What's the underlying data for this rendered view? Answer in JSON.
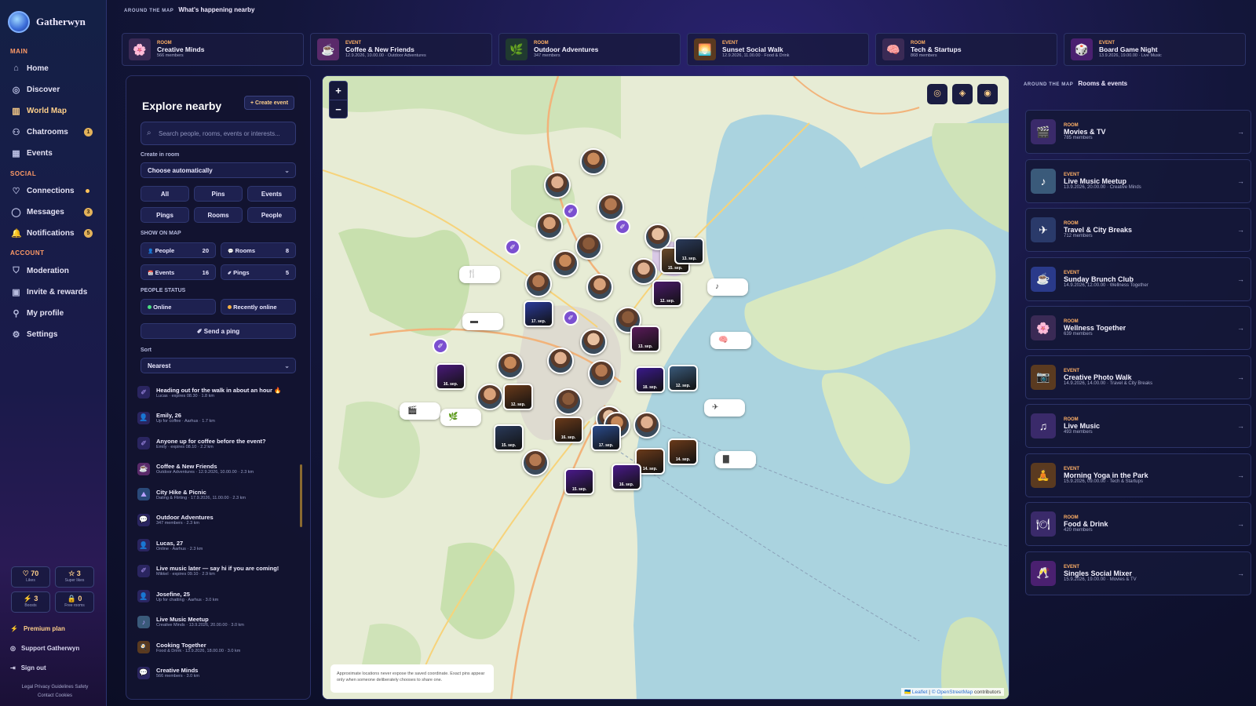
{
  "app": {
    "name": "Gatherwyn"
  },
  "sidebar": {
    "sections": {
      "main": "MAIN",
      "social": "SOCIAL",
      "account": "ACCOUNT"
    },
    "main_items": [
      {
        "label": "Home",
        "icon": "home-icon"
      },
      {
        "label": "Discover",
        "icon": "compass-icon"
      },
      {
        "label": "World Map",
        "icon": "map-icon",
        "active": true
      },
      {
        "label": "Chatrooms",
        "icon": "users-icon",
        "badge": "1"
      },
      {
        "label": "Events",
        "icon": "calendar-icon"
      }
    ],
    "social_items": [
      {
        "label": "Connections",
        "icon": "heart-icon"
      },
      {
        "label": "Messages",
        "icon": "chat-icon",
        "badge": "3"
      },
      {
        "label": "Notifications",
        "icon": "bell-icon",
        "badge": "5"
      }
    ],
    "account_items": [
      {
        "label": "Moderation",
        "icon": "shield-icon"
      },
      {
        "label": "Invite & rewards",
        "icon": "gift-icon"
      },
      {
        "label": "My profile",
        "icon": "user-icon"
      },
      {
        "label": "Settings",
        "icon": "gear-icon"
      }
    ],
    "stats": [
      {
        "value": "70",
        "label": "Likes",
        "icon": "♡"
      },
      {
        "value": "3",
        "label": "Super likes",
        "icon": "☆"
      },
      {
        "value": "3",
        "label": "Boosts",
        "icon": "⚡"
      },
      {
        "value": "0",
        "label": "Free rooms",
        "icon": "🔒"
      }
    ],
    "premium": "Premium plan",
    "support": "Support Gatherwyn",
    "signout": "Sign out",
    "legal_line1": "Legal   Privacy   Guidelines   Safety",
    "legal_line2": "Contact   Cookies"
  },
  "topbar": {
    "kicker": "AROUND THE MAP",
    "title": "What's happening nearby"
  },
  "strip": [
    {
      "type": "ROOM",
      "name": "Creative Minds",
      "sub": "566 members",
      "color": "#3a2a55",
      "glyph": "🌸"
    },
    {
      "type": "EVENT",
      "name": "Coffee & New Friends",
      "sub": "12.9.2026, 10.00.00 · Outdoor Adventures",
      "color": "#5a2a6a",
      "glyph": "☕"
    },
    {
      "type": "ROOM",
      "name": "Outdoor Adventures",
      "sub": "347 members",
      "color": "#203a30",
      "glyph": "🌿"
    },
    {
      "type": "EVENT",
      "name": "Sunset Social Walk",
      "sub": "12.9.2026, 11.00.00 · Food & Drink",
      "color": "#5a3a20",
      "glyph": "🌅"
    },
    {
      "type": "ROOM",
      "name": "Tech & Startups",
      "sub": "868 members",
      "color": "#3a2a55",
      "glyph": "🧠"
    },
    {
      "type": "EVENT",
      "name": "Board Game Night",
      "sub": "13.9.2026, 19.00.00 · Live Music",
      "color": "#4a2070",
      "glyph": "🎲"
    }
  ],
  "explore": {
    "title": "Explore nearby",
    "create_button": "+ Create event",
    "search_placeholder": "Search people, rooms, events or interests...",
    "create_in_room_label": "Create in room",
    "room_select": "Choose automatically",
    "filters_row1": [
      "All",
      "Pins",
      "Events"
    ],
    "filters_row2": [
      "Pings",
      "Rooms",
      "People"
    ],
    "show_on_map_label": "SHOW ON MAP",
    "show_counts": [
      {
        "label": "People",
        "count": "20",
        "icon": "👤"
      },
      {
        "label": "Rooms",
        "count": "8",
        "icon": "💬"
      },
      {
        "label": "Events",
        "count": "16",
        "icon": "📅"
      },
      {
        "label": "Pings",
        "count": "5",
        "icon": "✐"
      }
    ],
    "people_status_label": "PEOPLE STATUS",
    "status": [
      {
        "label": "Online",
        "color": "#4ade80"
      },
      {
        "label": "Recently online",
        "color": "#f5b042"
      }
    ],
    "send_ping": "Send a ping",
    "sort_label": "Sort",
    "sort_value": "Nearest",
    "items": [
      {
        "title": "Heading out for the walk in about an hour 🔥",
        "sub": "Lucas · expires 08.30 · 1.8 km",
        "icon": "✐",
        "bg": "#2a2560"
      },
      {
        "title": "Emily, 26",
        "sub": "Up for coffee · Aarhus · 1.7 km",
        "icon": "👤",
        "bg": "#2a2560"
      },
      {
        "title": "Anyone up for coffee before the event?",
        "sub": "Emily · expires 08.10 · 2.2 km",
        "icon": "✐",
        "bg": "#2a2560"
      },
      {
        "title": "Coffee & New Friends",
        "sub": "Outdoor Adventures · 12.9.2026, 10.00.00 · 2.3 km",
        "icon": "☕",
        "bg": "#5a2a6a"
      },
      {
        "title": "City Hike & Picnic",
        "sub": "Dating & Flirting · 17.9.2026, 11.00.00 · 2.3 km",
        "icon": "⛰",
        "bg": "#2a4a7a"
      },
      {
        "title": "Outdoor Adventures",
        "sub": "347 members · 2.3 km",
        "icon": "💬",
        "bg": "#2a2560"
      },
      {
        "title": "Lucas, 27",
        "sub": "Online · Aarhus · 2.3 km",
        "icon": "👤",
        "bg": "#2a2560"
      },
      {
        "title": "Live music later — say hi if you are coming!",
        "sub": "Mikkel · expires 09.10 · 2.9 km",
        "icon": "✐",
        "bg": "#2a2560"
      },
      {
        "title": "Josefine, 25",
        "sub": "Up for chatting · Aarhus · 3.0 km",
        "icon": "👤",
        "bg": "#2a2560"
      },
      {
        "title": "Live Music Meetup",
        "sub": "Creative Minds · 13.9.2026, 20.00.00 · 3.0 km",
        "icon": "♪",
        "bg": "#3a5a7a"
      },
      {
        "title": "Cooking Together",
        "sub": "Food & Drink · 13.9.2026, 18.00.00 · 3.0 km",
        "icon": "🍳",
        "bg": "#5a3a20"
      },
      {
        "title": "Creative Minds",
        "sub": "566 members · 3.0 km",
        "icon": "💬",
        "bg": "#2a2560"
      }
    ]
  },
  "map": {
    "zoom_in": "+",
    "zoom_out": "−",
    "tools": [
      "◎",
      "◈",
      "◉"
    ],
    "note": "Approximate locations never expose the saved coordinate. Exact pins appear only when someone deliberately chooses to share one.",
    "attribution_leaflet": "Leaflet",
    "attribution_osm": "© OpenStreetMap",
    "attribution_rest": "contributors",
    "event_labels": [
      "17. sep.",
      "16. sep.",
      "12. sep.",
      "13. sep.",
      "15. sep.",
      "12. sep.",
      "18. sep.",
      "12. sep.",
      "15. sep.",
      "16. sep.",
      "17. sep.",
      "14. sep.",
      "14. sep.",
      "15. sep.",
      "16. sep.",
      "13. sep."
    ]
  },
  "right_panel": {
    "kicker": "AROUND THE MAP",
    "title": "Rooms & events",
    "cards": [
      {
        "type": "ROOM",
        "name": "Movies & TV",
        "sub": "785 members",
        "glyph": "🎬",
        "color": "#3a2a6a"
      },
      {
        "type": "EVENT",
        "name": "Live Music Meetup",
        "sub": "13.9.2026, 20.00.00 · Creative Minds",
        "glyph": "♪",
        "color": "#3a5a7a"
      },
      {
        "type": "ROOM",
        "name": "Travel & City Breaks",
        "sub": "712 members",
        "glyph": "✈",
        "color": "#2a3a6a"
      },
      {
        "type": "EVENT",
        "name": "Sunday Brunch Club",
        "sub": "14.9.2026, 12.00.00 · Wellness Together",
        "glyph": "☕",
        "color": "#2a3a8a"
      },
      {
        "type": "ROOM",
        "name": "Wellness Together",
        "sub": "639 members",
        "glyph": "🌸",
        "color": "#3a2a55"
      },
      {
        "type": "EVENT",
        "name": "Creative Photo Walk",
        "sub": "14.9.2026, 14.00.00 · Travel & City Breaks",
        "glyph": "📷",
        "color": "#5a3a20"
      },
      {
        "type": "ROOM",
        "name": "Live Music",
        "sub": "493 members",
        "glyph": "♫",
        "color": "#3a2a6a"
      },
      {
        "type": "EVENT",
        "name": "Morning Yoga in the Park",
        "sub": "15.9.2026, 09.00.00 · Tech & Startups",
        "glyph": "🧘",
        "color": "#5a3a20"
      },
      {
        "type": "ROOM",
        "name": "Food & Drink",
        "sub": "420 members",
        "glyph": "🍽",
        "color": "#3a2a6a"
      },
      {
        "type": "EVENT",
        "name": "Singles Social Mixer",
        "sub": "15.9.2026, 19.00.00 · Movies & TV",
        "glyph": "🥂",
        "color": "#4a2070"
      }
    ]
  },
  "colors": {
    "accent": "#ffd08a",
    "type_label": "#ffb066",
    "water": "#aad3df",
    "land": "#e9ecd8",
    "room_marker": "#7b4fd0"
  }
}
